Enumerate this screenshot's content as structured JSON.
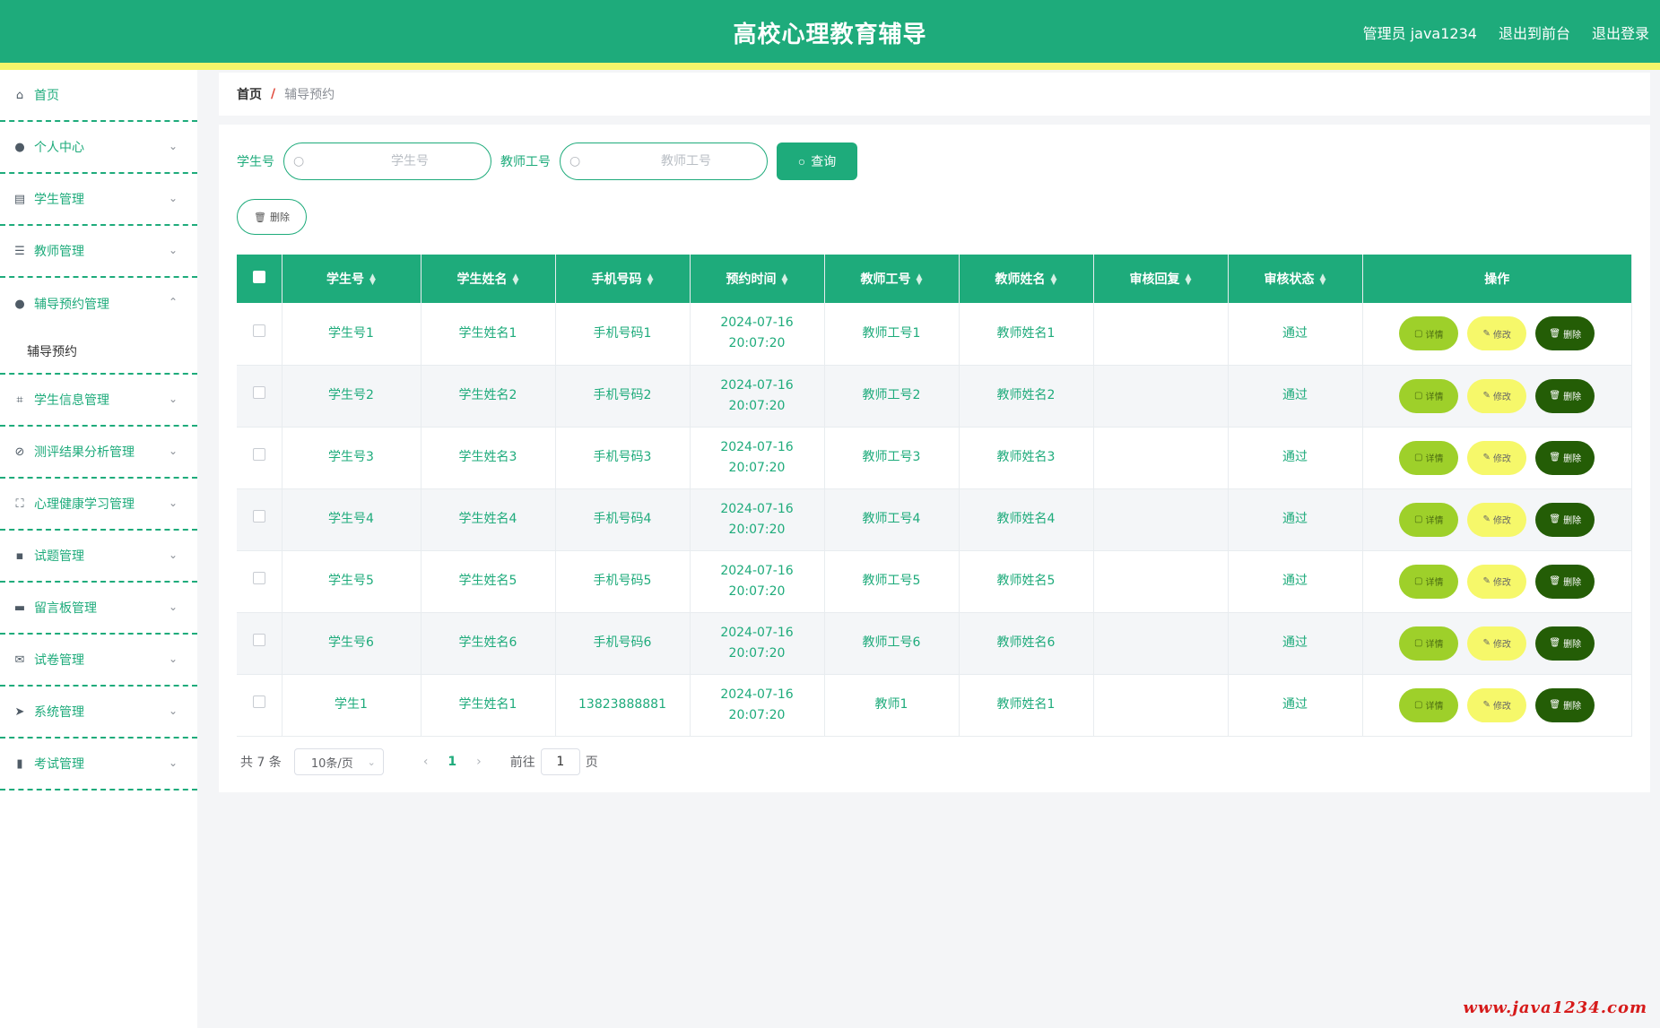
{
  "header": {
    "title": "高校心理教育辅导",
    "user": "管理员 java1234",
    "to_front": "退出到前台",
    "logout": "退出登录"
  },
  "sidebar": {
    "items": [
      {
        "label": "首页",
        "icon": "home-icon"
      },
      {
        "label": "个人中心",
        "icon": "user-icon"
      },
      {
        "label": "学生管理",
        "icon": "clipboard-icon"
      },
      {
        "label": "教师管理",
        "icon": "list-icon"
      },
      {
        "label": "辅导预约管理",
        "icon": "user-icon"
      },
      {
        "label": "辅导预约",
        "icon": ""
      },
      {
        "label": "学生信息管理",
        "icon": "crop-icon"
      },
      {
        "label": "测评结果分析管理",
        "icon": "bell-off-icon"
      },
      {
        "label": "心理健康学习管理",
        "icon": "fullscreen-icon"
      },
      {
        "label": "试题管理",
        "icon": "chat-icon"
      },
      {
        "label": "留言板管理",
        "icon": "printer-icon"
      },
      {
        "label": "试卷管理",
        "icon": "mail-icon"
      },
      {
        "label": "系统管理",
        "icon": "send-icon"
      },
      {
        "label": "考试管理",
        "icon": "bar-chart-icon"
      }
    ]
  },
  "breadcrumb": {
    "home": "首页",
    "sep": "/",
    "current": "辅导预约"
  },
  "search": {
    "student_label": "学生号",
    "student_placeholder": "学生号",
    "teacher_label": "教师工号",
    "teacher_placeholder": "教师工号",
    "query_label": "查询"
  },
  "toolbar": {
    "delete_label": "删除"
  },
  "table": {
    "columns": [
      "学生号",
      "学生姓名",
      "手机号码",
      "预约时间",
      "教师工号",
      "教师姓名",
      "审核回复",
      "审核状态",
      "操作"
    ],
    "rows": [
      [
        "学生号1",
        "学生姓名1",
        "手机号码1",
        "2024-07-16 20:07:20",
        "教师工号1",
        "教师姓名1",
        "",
        "通过"
      ],
      [
        "学生号2",
        "学生姓名2",
        "手机号码2",
        "2024-07-16 20:07:20",
        "教师工号2",
        "教师姓名2",
        "",
        "通过"
      ],
      [
        "学生号3",
        "学生姓名3",
        "手机号码3",
        "2024-07-16 20:07:20",
        "教师工号3",
        "教师姓名3",
        "",
        "通过"
      ],
      [
        "学生号4",
        "学生姓名4",
        "手机号码4",
        "2024-07-16 20:07:20",
        "教师工号4",
        "教师姓名4",
        "",
        "通过"
      ],
      [
        "学生号5",
        "学生姓名5",
        "手机号码5",
        "2024-07-16 20:07:20",
        "教师工号5",
        "教师姓名5",
        "",
        "通过"
      ],
      [
        "学生号6",
        "学生姓名6",
        "手机号码6",
        "2024-07-16 20:07:20",
        "教师工号6",
        "教师姓名6",
        "",
        "通过"
      ],
      [
        "学生1",
        "学生姓名1",
        "13823888881",
        "2024-07-16 20:07:20",
        "教师1",
        "教师姓名1",
        "",
        "通过"
      ]
    ],
    "actions": {
      "detail": "详情",
      "edit": "修改",
      "delete": "删除"
    }
  },
  "pagination": {
    "total": "共 7 条",
    "page_size": "10条/页",
    "current_page": "1",
    "goto_prefix": "前往",
    "goto_value": "1",
    "goto_suffix": "页"
  },
  "watermark": "www.java1234.com",
  "colors": {
    "primary": "#1eab7b",
    "accent_yellow": "#f3f56a",
    "detail": "#9ed02a",
    "edit": "#f6f86a",
    "delete": "#245d06"
  }
}
